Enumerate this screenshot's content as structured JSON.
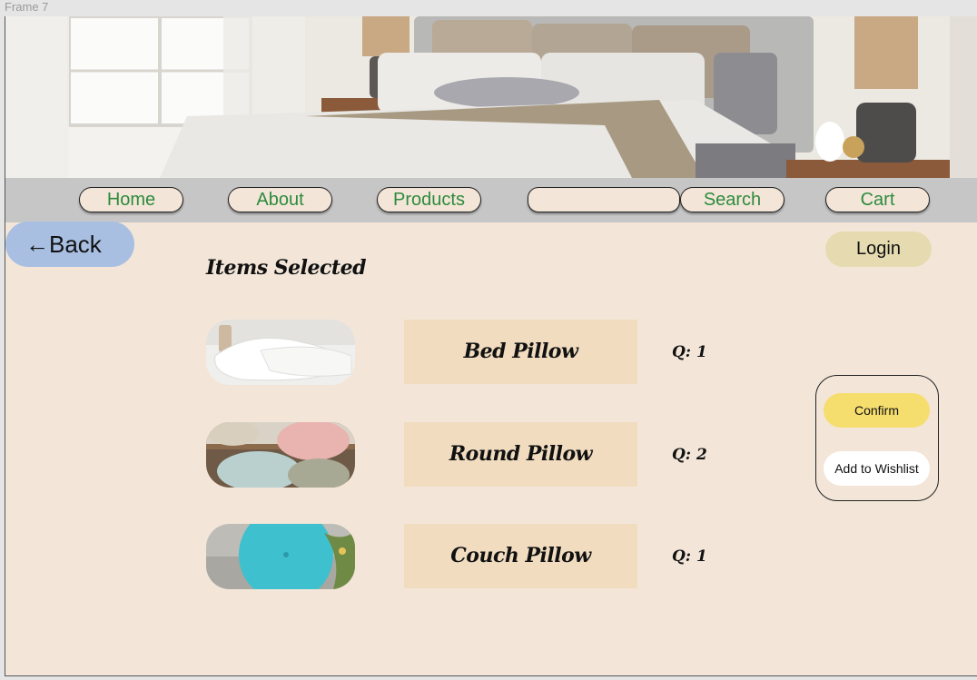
{
  "frame_label": "Frame 7",
  "nav": {
    "home": "Home",
    "about": "About",
    "products": "Products",
    "search_value": "",
    "search_button": "Search",
    "cart": "Cart"
  },
  "back_label": "←Back",
  "login_label": "Login",
  "section_title": "Items Selected",
  "items": [
    {
      "name": "Bed Pillow",
      "qty": "Q: 1",
      "image": "bed-pillow-photo"
    },
    {
      "name": "Round Pillow",
      "qty": "Q: 2",
      "image": "round-pillow-photo"
    },
    {
      "name": "Couch Pillow",
      "qty": "Q: 1",
      "image": "couch-pillow-photo"
    }
  ],
  "actions": {
    "confirm": "Confirm",
    "wishlist": "Add to Wishlist"
  },
  "colors": {
    "background": "#f3e6d8",
    "nav_bar": "#c6c6c6",
    "nav_text": "#2e8a3e",
    "back_button": "#a8bfe2",
    "login_button": "#e6dbb0",
    "confirm_button": "#f5dd6e",
    "item_name_box": "#f1dcc0"
  }
}
